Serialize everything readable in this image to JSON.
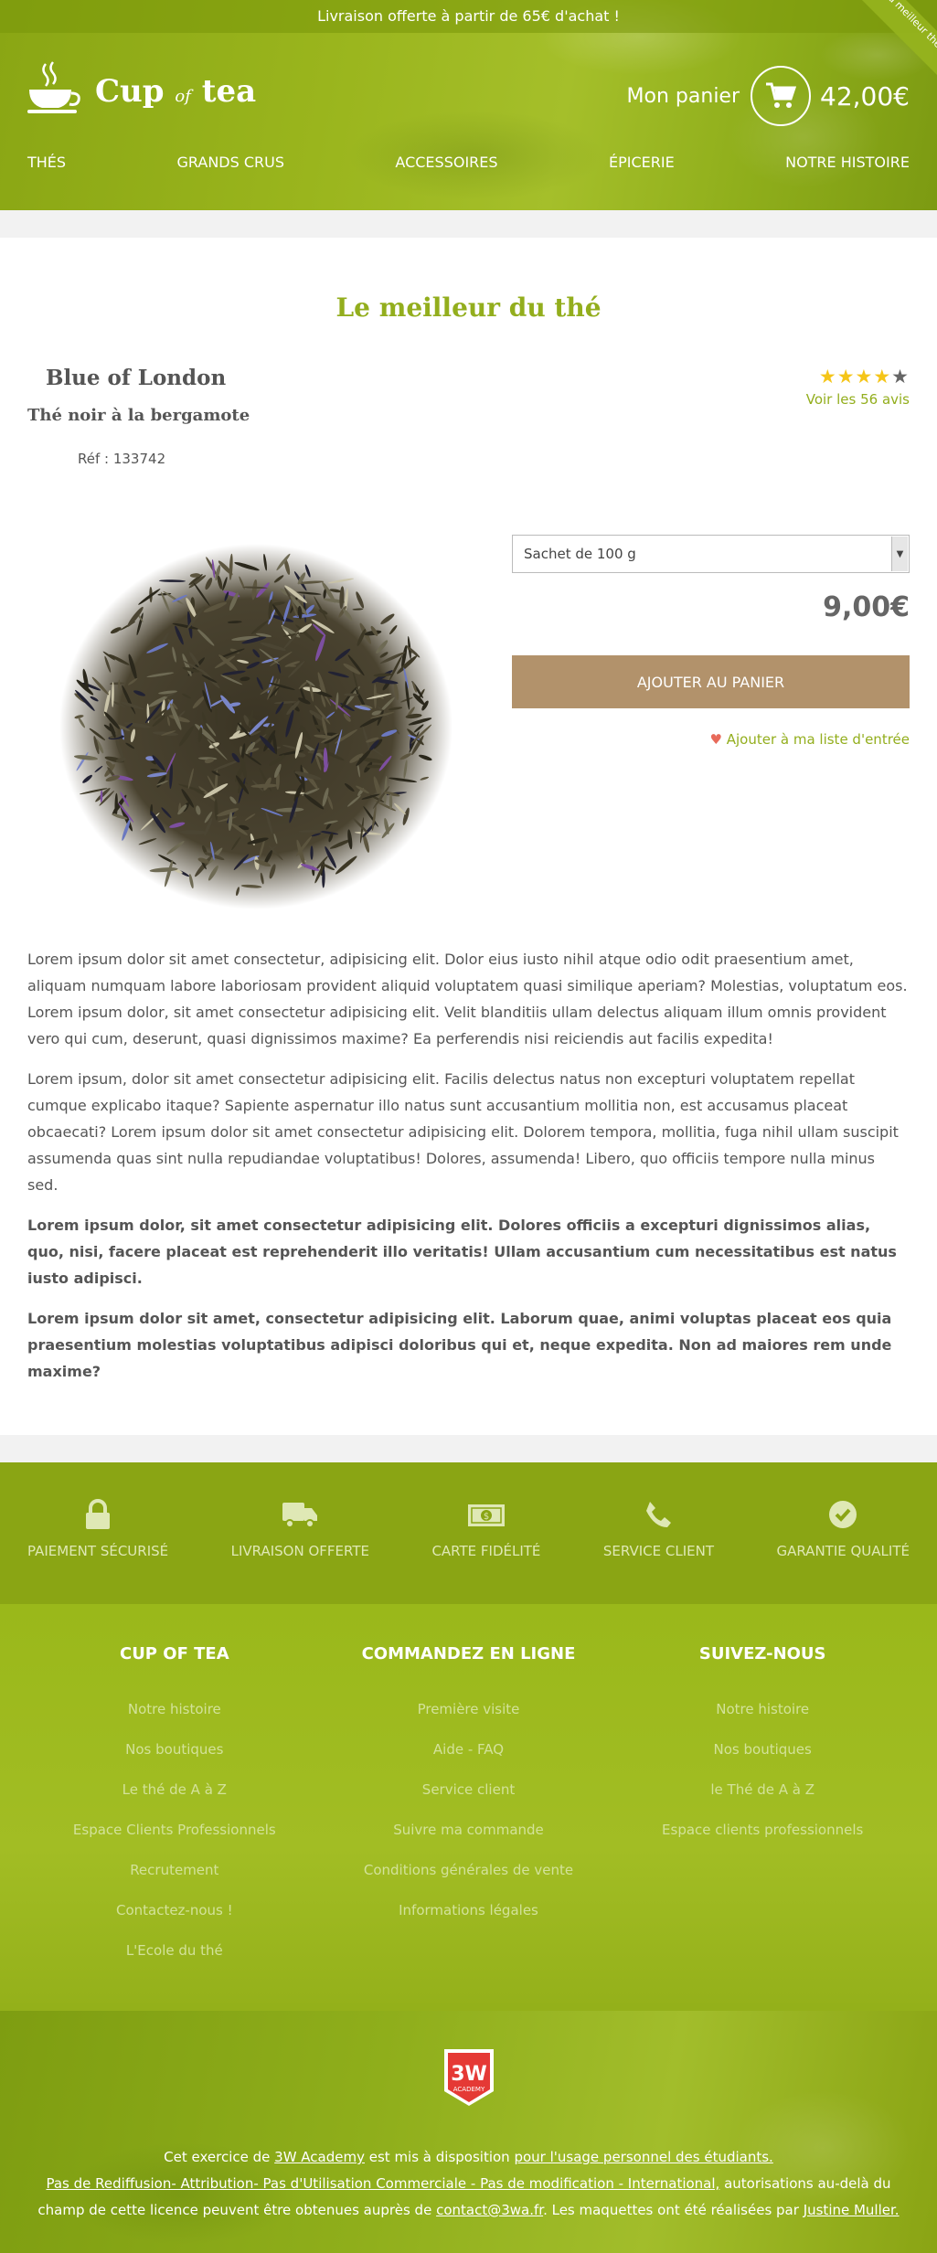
{
  "topbar": {
    "text": "Livraison offerte à partir de 65€ d'achat !",
    "ribbon": "Élu meilleur thé"
  },
  "logo": {
    "text_cup": "Cup",
    "text_of": "of",
    "text_tea": "tea"
  },
  "cart": {
    "label": "Mon panier",
    "total": "42,00€",
    "icon": "cart-icon"
  },
  "nav": {
    "items": [
      "THÉS",
      "GRANDS CRUS",
      "ACCESSOIRES",
      "ÉPICERIE",
      "NOTRE HISTOIRE"
    ]
  },
  "main": {
    "title": "Le meilleur du thé",
    "product": {
      "name": "Blue of London",
      "subtitle": "Thé noir à la bergamote",
      "ref": "Réf : 133742",
      "rating": 4,
      "rating_max": 5,
      "reviews": "Voir les 56 avis",
      "option": "Sachet de 100 g",
      "price": "9,00€",
      "add_button": "AJOUTER AU PANIER",
      "wishlist": "Ajouter à ma liste d'entrée"
    },
    "description": [
      "Lorem ipsum dolor sit amet consectetur, adipisicing elit. Dolor eius iusto nihil atque odio odit praesentium amet, aliquam numquam labore laboriosam provident aliquid voluptatem quasi similique aperiam? Molestias, voluptatum eos. Lorem ipsum dolor, sit amet consectetur adipisicing elit. Velit blanditiis ullam delectus aliquam illum omnis provident vero qui cum, deserunt, quasi dignissimos maxime? Ea perferendis nisi reiciendis aut facilis expedita!",
      "Lorem ipsum, dolor sit amet consectetur adipisicing elit. Facilis delectus natus non excepturi voluptatem repellat cumque explicabo itaque? Sapiente aspernatur illo natus sunt accusantium mollitia non, est accusamus placeat obcaecati? Lorem ipsum dolor sit amet consectetur adipisicing elit. Dolorem tempora, mollitia, fuga nihil ullam suscipit assumenda quas sint nulla repudiandae voluptatibus! Dolores, assumenda! Libero, quo officiis tempore nulla minus sed.",
      "Lorem ipsum dolor, sit amet consectetur adipisicing elit. Dolores officiis a excepturi dignissimos alias, quo, nisi, facere placeat est reprehenderit illo veritatis! Ullam accusantium cum necessitatibus est natus iusto adipisci.",
      "Lorem ipsum dolor sit amet, consectetur adipisicing elit. Laborum quae, animi voluptas placeat eos quia praesentium molestias voluptatibus adipisci doloribus qui et, neque expedita. Non ad maiores rem unde maxime?"
    ]
  },
  "services": [
    {
      "icon": "lock-icon",
      "label": "PAIEMENT SÉCURISÉ"
    },
    {
      "icon": "truck-icon",
      "label": "LIVRAISON OFFERTE"
    },
    {
      "icon": "money-icon",
      "label": "CARTE FIDÉLITÉ"
    },
    {
      "icon": "phone-icon",
      "label": "SERVICE CLIENT"
    },
    {
      "icon": "check-circle-icon",
      "label": "GARANTIE QUALITÉ"
    }
  ],
  "footer": {
    "columns": [
      {
        "title": "CUP OF TEA",
        "links": [
          "Notre histoire",
          "Nos boutiques",
          "Le thé de A à Z",
          "Espace Clients Professionnels",
          "Recrutement",
          "Contactez-nous !",
          "L'Ecole du thé"
        ]
      },
      {
        "title": "COMMANDEZ EN LIGNE",
        "links": [
          "Première visite",
          "Aide - FAQ",
          "Service client",
          "Suivre ma commande",
          "Conditions générales de vente",
          "Informations légales"
        ]
      },
      {
        "title": "SUIVEZ-NOUS",
        "links": [
          "Notre histoire",
          "Nos boutiques",
          "le Thé de A à Z",
          "Espace clients professionnels"
        ]
      }
    ]
  },
  "bottom": {
    "badge_top": "3W",
    "badge_bottom": "ACADEMY",
    "l1_a": "Cet exercice de ",
    "l1_link": "3W Academy",
    "l1_b": " est mis à disposition ",
    "l1_link2": "pour l'usage personnel des étudiants.",
    "l2_link": "Pas de Rediffusion- Attribution- Pas d'Utilisation Commerciale - Pas de modification - International,",
    "l2_b": " autorisations au-delà du",
    "l3_a": "champ de cette licence peuvent être obtenues auprès de ",
    "l3_link": "contact@3wa.fr",
    "l3_b": ". Les maquettes ont été réalisées par ",
    "l3_link2": "Justine Muller."
  }
}
